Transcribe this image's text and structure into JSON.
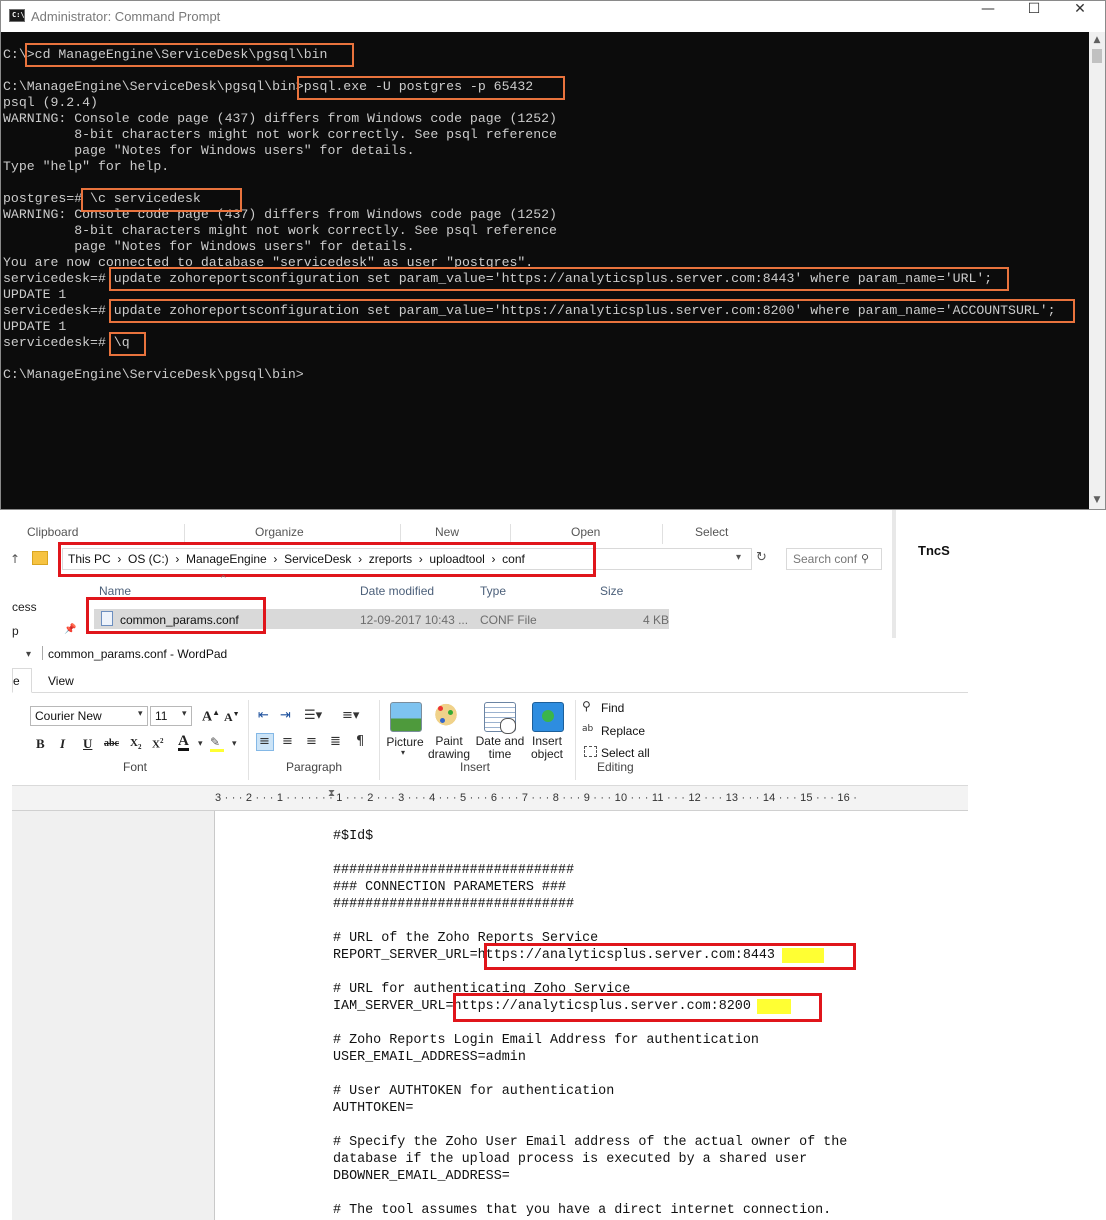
{
  "cmd": {
    "title": "Administrator: Command Prompt",
    "icon_label": "C:\\.",
    "window_buttons": [
      "—",
      "☐",
      "✕"
    ],
    "lines": [
      "C:\\>cd ManageEngine\\ServiceDesk\\pgsql\\bin",
      "",
      "C:\\ManageEngine\\ServiceDesk\\pgsql\\bin>psql.exe -U postgres -p 65432",
      "psql (9.2.4)",
      "WARNING: Console code page (437) differs from Windows code page (1252)",
      "         8-bit characters might not work correctly. See psql reference",
      "         page \"Notes for Windows users\" for details.",
      "Type \"help\" for help.",
      "",
      "postgres=# \\c servicedesk",
      "WARNING: Console code page (437) differs from Windows code page (1252)",
      "         8-bit characters might not work correctly. See psql reference",
      "         page \"Notes for Windows users\" for details.",
      "You are now connected to database \"servicedesk\" as user \"postgres\".",
      "servicedesk=# update zohoreportsconfiguration set param_value='https://analyticsplus.server.com:8443' where param_name='URL';",
      "UPDATE 1",
      "servicedesk=# update zohoreportsconfiguration set param_value='https://analyticsplus.server.com:8200' where param_name='ACCOUNTSURL';",
      "UPDATE 1",
      "servicedesk=# \\q",
      "",
      "C:\\ManageEngine\\ServiceDesk\\pgsql\\bin>"
    ]
  },
  "explorer": {
    "groups": [
      "Clipboard",
      "Organize",
      "New",
      "Open",
      "Select"
    ],
    "breadcrumb": "This PC  ›  OS (C:)  ›  ManageEngine  ›  ServiceDesk  ›  zreports  ›  uploadtool  ›  conf",
    "search_placeholder": "Search conf",
    "columns": [
      "Name",
      "Date modified",
      "Type",
      "Size"
    ],
    "file": {
      "name": "common_params.conf",
      "date": "12-09-2017 10:43 ...",
      "type": "CONF File",
      "size": "4 KB"
    },
    "side_labels": [
      "cess",
      "p"
    ],
    "overflow_text": "TncS"
  },
  "wordpad": {
    "title": "common_params.conf - WordPad",
    "tabs": [
      "e",
      "View"
    ],
    "font_name": "Courier New",
    "font_size": "11",
    "group_labels": [
      "Font",
      "Paragraph",
      "Insert",
      "Editing"
    ],
    "insert_items": [
      {
        "label": "Picture",
        "icon": "picture-icon"
      },
      {
        "label": "Paint drawing",
        "icon": "paint-icon"
      },
      {
        "label": "Date and time",
        "icon": "calendar-icon"
      },
      {
        "label": "Insert object",
        "icon": "object-icon"
      }
    ],
    "editing_items": [
      "Find",
      "Replace",
      "Select all"
    ],
    "ruler": "3 · · · 2 · · · 1 · · · · · · · 1 · · · 2 · · · 3 · · · 4 · · · 5 · · · 6 · · · 7 · · · 8 · · · 9 · · · 10 · · · 11 · · · 12 · · · 13 · · · 14 · · · 15 · · · 16 ·",
    "doc_lines": [
      "#$Id$",
      "",
      "##############################",
      "### CONNECTION PARAMETERS ###",
      "##############################",
      "",
      "# URL of the Zoho Reports Service",
      "REPORT_SERVER_URL=https://analyticsplus.server.com:8443",
      "",
      "# URL for authenticating Zoho Service",
      "IAM_SERVER_URL=https://analyticsplus.server.com:8200",
      "",
      "# Zoho Reports Login Email Address for authentication",
      "USER_EMAIL_ADDRESS=admin",
      "",
      "# User AUTHTOKEN for authentication",
      "AUTHTOKEN=",
      "",
      "# Specify the Zoho User Email address of the actual owner of the",
      "database if the upload process is executed by a shared user",
      "DBOWNER_EMAIL_ADDRESS=",
      "",
      "# The tool assumes that you have a direct internet connection."
    ],
    "highlight_ports": [
      "8443",
      "8200"
    ],
    "highlight_color": "#ffff33",
    "annotation_color": "#e0151b"
  }
}
